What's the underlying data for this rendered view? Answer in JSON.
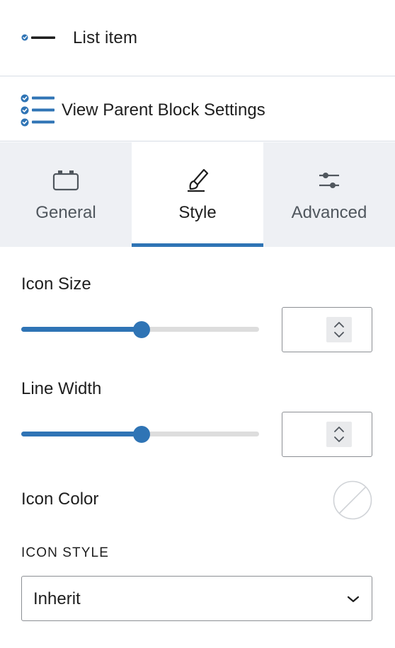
{
  "block": {
    "title": "List item",
    "icon": "list-item-icon"
  },
  "parent": {
    "label": "View Parent Block Settings",
    "icon": "checklist-icon"
  },
  "tabs": [
    {
      "label": "General",
      "icon": "toolbox-icon",
      "active": false
    },
    {
      "label": "Style",
      "icon": "brush-icon",
      "active": true
    },
    {
      "label": "Advanced",
      "icon": "sliders-icon",
      "active": false
    }
  ],
  "controls": {
    "icon_size": {
      "label": "Icon Size",
      "value": "",
      "slider_fraction": 0.505
    },
    "line_width": {
      "label": "Line Width",
      "value": "",
      "slider_fraction": 0.505
    },
    "icon_color": {
      "label": "Icon Color",
      "value": "none"
    },
    "icon_style": {
      "heading": "ICON STYLE",
      "selected": "Inherit"
    }
  },
  "colors": {
    "accent": "#2f74b5",
    "border": "#d7dde5",
    "tab_background": "#eef0f4",
    "text": "#1e1e1e",
    "muted_text": "#50575e"
  }
}
